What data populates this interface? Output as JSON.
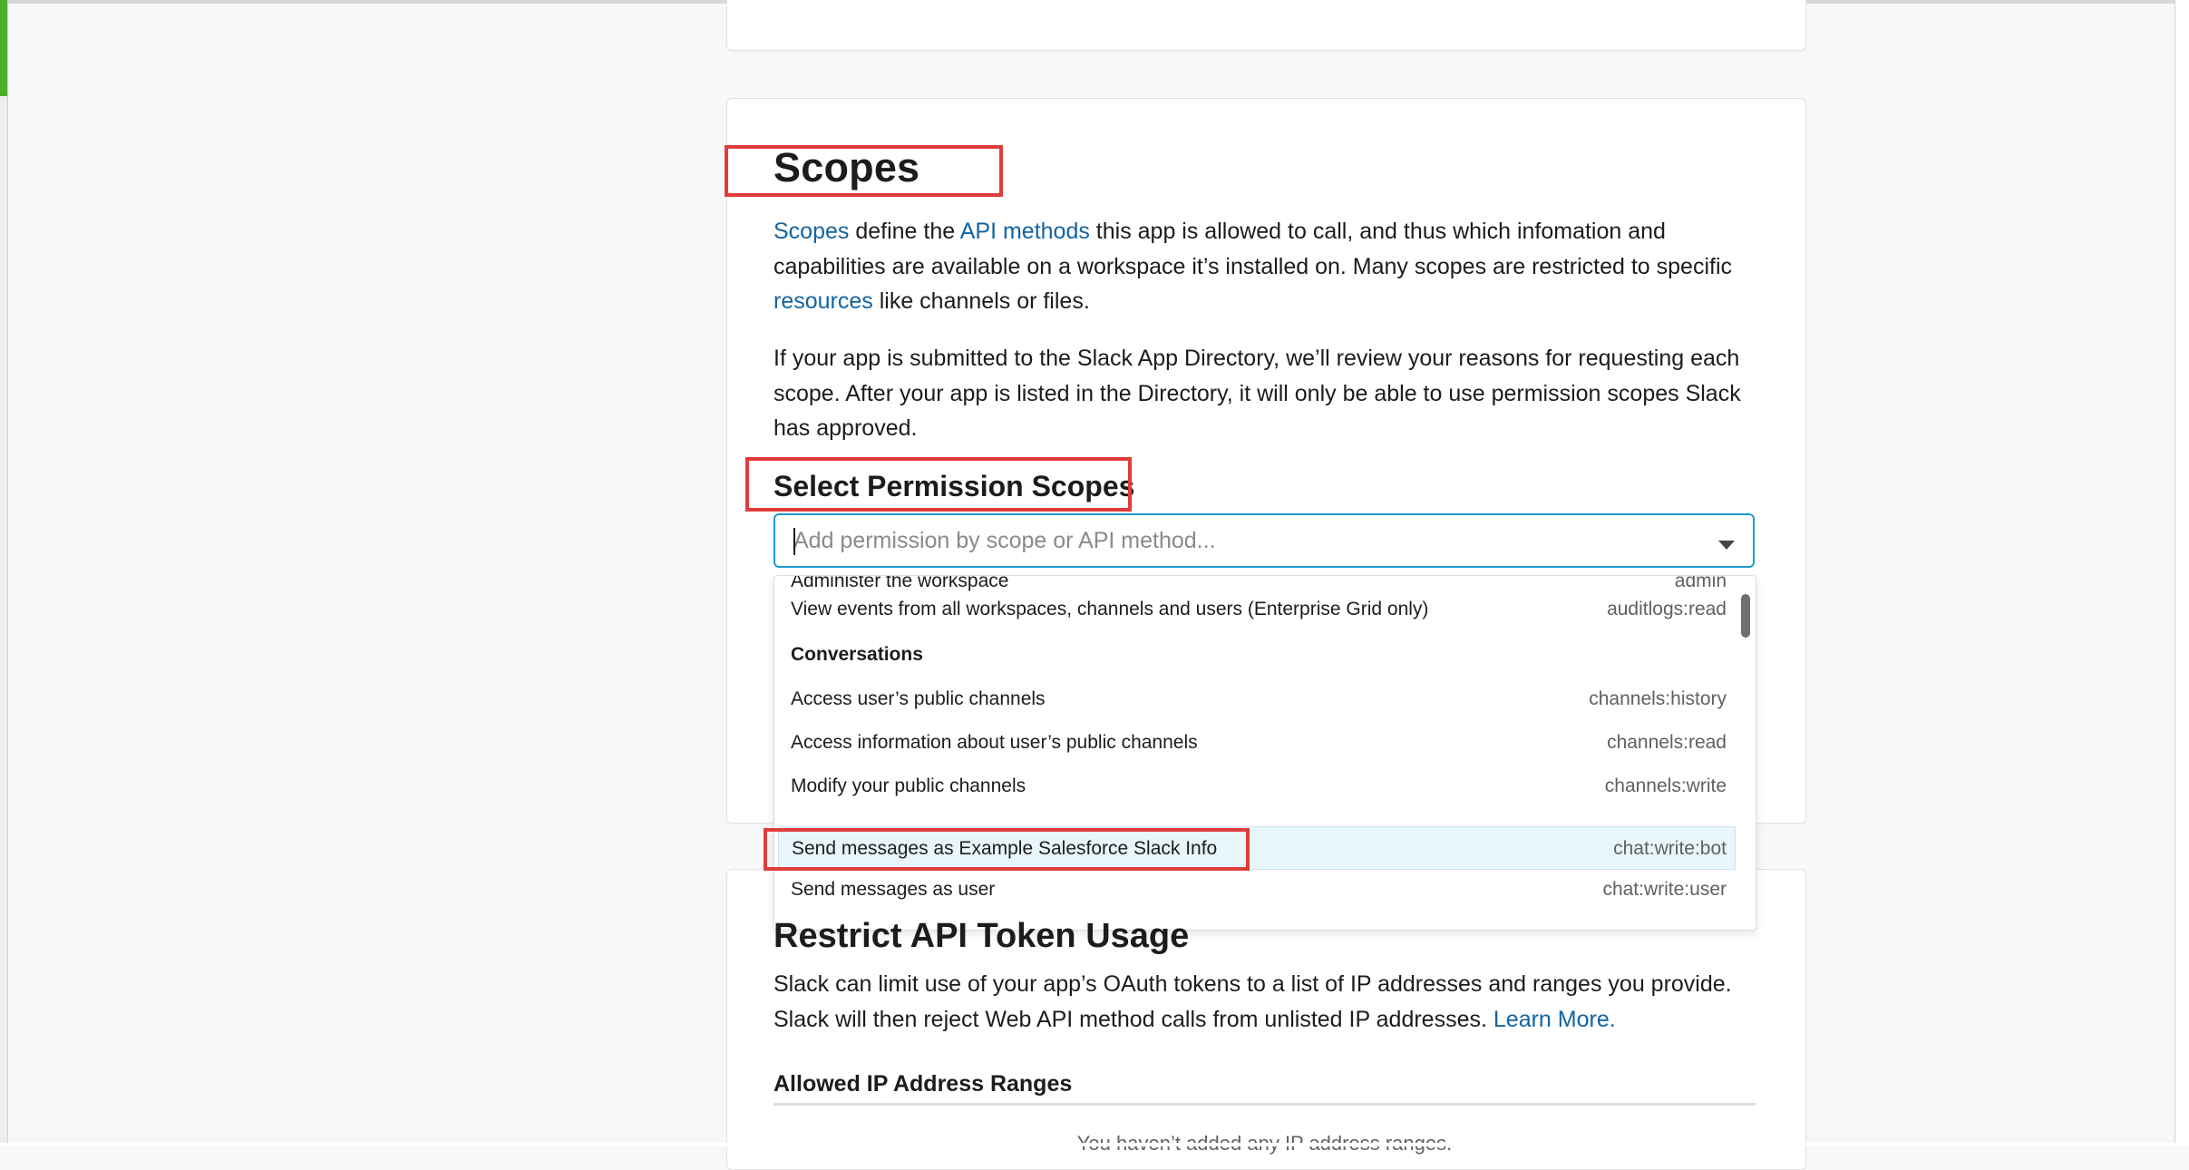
{
  "scopes_section": {
    "title": "Scopes",
    "intro": {
      "link_scopes": "Scopes",
      "text_a": " define the ",
      "link_api_methods": "API methods",
      "text_b": " this app is allowed to call, and thus which infomation and capabilities are available on a workspace it’s installed on. Many scopes are restricted to specific ",
      "link_resources": "resources",
      "text_c": " like channels or files."
    },
    "review_note": "If your app is submitted to the Slack App Directory, we’ll review your reasons for requesting each scope. After your app is listed in the Directory, it will only be able to use permission scopes Slack has approved.",
    "select_title": "Select Permission Scopes",
    "search": {
      "placeholder": "Add permission by scope or API method...",
      "value": ""
    },
    "dropdown": {
      "partial_option": {
        "label": "Administer the workspace",
        "scope": "admin"
      },
      "options_before_group": [
        {
          "label": "View events from all workspaces, channels and users (Enterprise Grid only)",
          "scope": "auditlogs:read"
        }
      ],
      "group_label": "Conversations",
      "group_options": [
        {
          "label": "Access user’s public channels",
          "scope": "channels:history"
        },
        {
          "label": "Access information about user’s public channels",
          "scope": "channels:read"
        },
        {
          "label": "Modify your public channels",
          "scope": "channels:write"
        },
        {
          "label": "Send messages as Example Salesforce Slack Info",
          "scope": "chat:write:bot",
          "highlighted": true
        },
        {
          "label": "Send messages as user",
          "scope": "chat:write:user"
        }
      ]
    }
  },
  "restrict_section": {
    "title": "Restrict API Token Usage",
    "description": "Slack can limit use of your app’s OAuth tokens to a list of IP addresses and ranges you provide. Slack will then reject Web API method calls from unlisted IP addresses. ",
    "learn_more": "Learn More.",
    "allowed_title": "Allowed IP Address Ranges",
    "empty_message": "You haven’t added any IP address ranges."
  },
  "colors": {
    "link": "#1264a3",
    "focus_border": "#1d9bd1",
    "annotation": "#e03c3c",
    "highlight_row": "#e8f5fa"
  }
}
